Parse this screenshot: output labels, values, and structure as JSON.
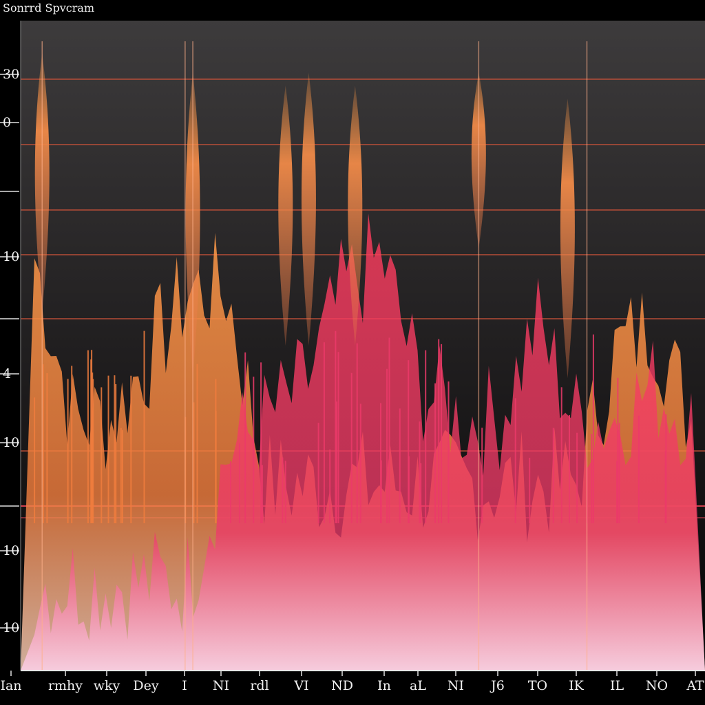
{
  "title": "Sonrrd Spvcram",
  "colors": {
    "background_top": "#3a3839",
    "background_bottom": "#050505",
    "gridline": "#d0543a",
    "orange": "#f07d3e",
    "bright_orange": "#ff9a48",
    "pink": "#ec3a6a",
    "magenta": "#ff5fa8",
    "label": "#f0f0f0"
  },
  "chart_data": {
    "type": "area",
    "title": "Sonrrd Spvcram",
    "xlabel": "",
    "ylabel": "",
    "y_tick_labels": [
      "30",
      "0",
      "",
      "10",
      "",
      "4",
      "10",
      "",
      "10",
      "10"
    ],
    "x_tick_labels": [
      "Ian",
      "rmhy",
      "wky",
      "Dey",
      "I",
      "NI",
      "rdl",
      "VI",
      "ND",
      "In",
      "aL",
      "NI",
      "J6",
      "TO",
      "IK",
      "IL",
      "NO",
      "AT"
    ],
    "horizontal_gridlines": 6,
    "grid": true,
    "series": [
      {
        "color": "orange",
        "x": [
          0,
          1,
          2,
          3,
          4,
          5,
          6,
          7,
          8,
          9,
          10,
          11,
          12,
          13,
          14,
          15,
          16,
          17
        ],
        "values": [
          0.6,
          0.35,
          0.35,
          0.45,
          0.55,
          0.55,
          0.25,
          0.25,
          0.25,
          0.25,
          0.25,
          0.25,
          0.25,
          0.25,
          0.25,
          0.45,
          0.5,
          0.35
        ]
      },
      {
        "color": "pink",
        "x": [
          0,
          1,
          2,
          3,
          4,
          5,
          6,
          7,
          8,
          9,
          10,
          11,
          12,
          13,
          14,
          15,
          16,
          17
        ],
        "values": [
          0.1,
          0.1,
          0.1,
          0.1,
          0.1,
          0.3,
          0.35,
          0.4,
          0.55,
          0.6,
          0.4,
          0.35,
          0.35,
          0.5,
          0.35,
          0.35,
          0.4,
          0.35
        ]
      }
    ],
    "upper_bursts": [
      {
        "x": 0.2,
        "top": 0.95,
        "bottom": 0.55
      },
      {
        "x": 4.1,
        "top": 0.92,
        "bottom": 0.45
      },
      {
        "x": 6.5,
        "top": 0.9,
        "bottom": 0.5
      },
      {
        "x": 7.1,
        "top": 0.92,
        "bottom": 0.5
      },
      {
        "x": 8.3,
        "top": 0.9,
        "bottom": 0.5
      },
      {
        "x": 11.5,
        "top": 0.92,
        "bottom": 0.65
      },
      {
        "x": 13.8,
        "top": 0.88,
        "bottom": 0.45
      }
    ]
  }
}
